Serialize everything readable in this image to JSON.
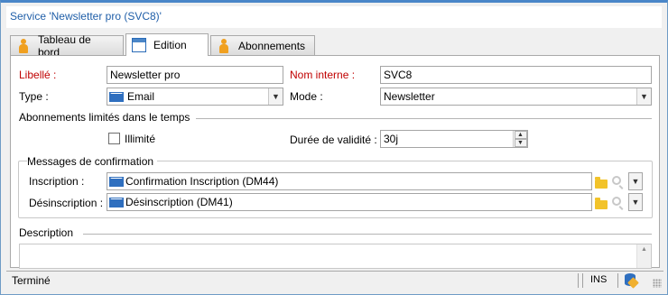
{
  "window": {
    "title": "Service 'Newsletter pro (SVC8)'"
  },
  "tabs": [
    {
      "label": "Tableau de bord",
      "icon": "person-icon",
      "active": false
    },
    {
      "label": "Edition",
      "icon": "edit-form-icon",
      "active": true
    },
    {
      "label": "Abonnements",
      "icon": "person-icon",
      "active": false
    }
  ],
  "form": {
    "libelle_label": "Libellé :",
    "libelle_value": "Newsletter pro",
    "nom_interne_label": "Nom interne :",
    "nom_interne_value": "SVC8",
    "type_label": "Type :",
    "type_value": "Email",
    "mode_label": "Mode :",
    "mode_value": "Newsletter",
    "abonnements_section": "Abonnements limités dans le temps",
    "illimite_label": "Illimité",
    "illimite_checked": false,
    "duree_label": "Durée de validité :",
    "duree_value": "30j",
    "messages_section": "Messages de confirmation",
    "inscription_label": "Inscription :",
    "inscription_value": "Confirmation Inscription (DM44)",
    "desinscription_label": "Désinscription :",
    "desinscription_value": "Désinscription (DM41)",
    "description_section": "Description",
    "description_value": ""
  },
  "status_bar": {
    "text": "Terminé",
    "mode": "INS"
  },
  "colors": {
    "required_label": "#c00000",
    "title_text": "#1f5ea8",
    "accent": "#4a86c8"
  }
}
